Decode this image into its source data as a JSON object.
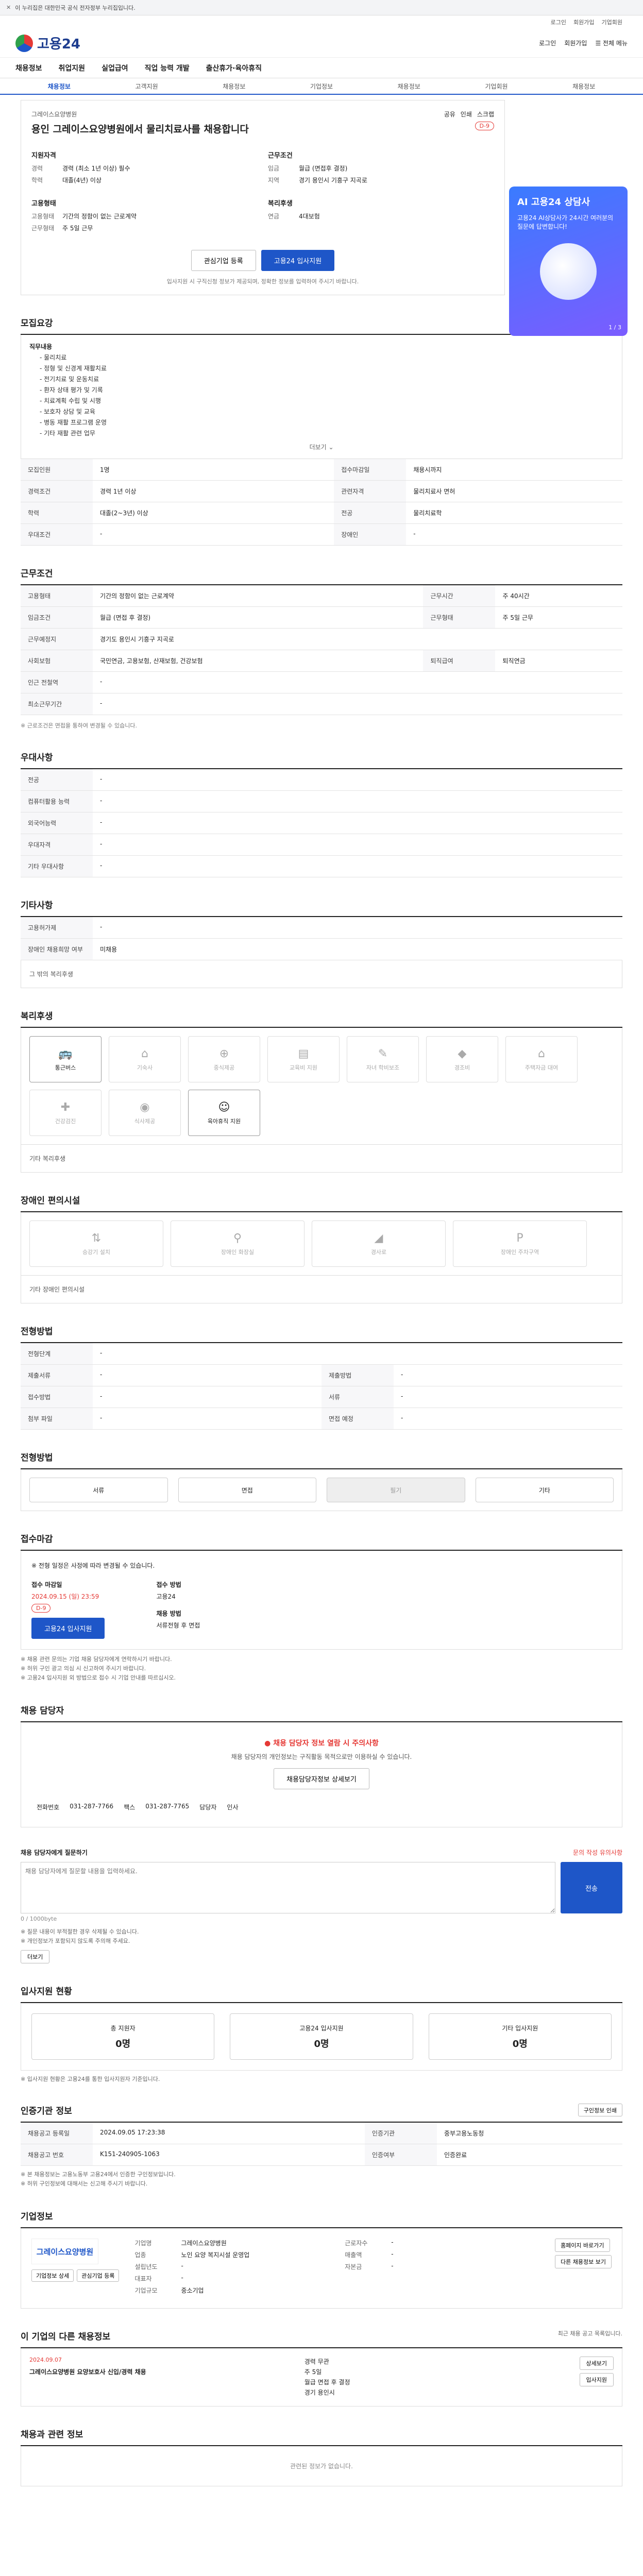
{
  "topbar": {
    "notice": "이 누리집은 대한민국 공식 전자정부 누리집입니다."
  },
  "gnb": [
    "로그인",
    "회원가입",
    "기업회원"
  ],
  "header": {
    "logo": "고용24",
    "links": [
      "로그인",
      "회원가입"
    ],
    "all_menu": "전체 메뉴"
  },
  "nav": [
    "채용정보",
    "취업지원",
    "실업급여",
    "직업 능력 개발",
    "출산휴가·육아휴직"
  ],
  "subnav": [
    "채용정보",
    "고객지원",
    "채용정보",
    "기업정보",
    "채용정보",
    "기업회원",
    "채용정보"
  ],
  "banner": {
    "title": "AI 고용24 상담사",
    "text": "고용24 AI상담사가 24시간 여러분의 질문에 답변합니다!",
    "page": "1 / 3"
  },
  "job": {
    "company": "그레이스요양병원",
    "title": "용인 그레이스요양병원에서 물리치료사를 채용합니다",
    "tools": [
      "공유",
      "인쇄",
      "스크랩"
    ],
    "badge": "D-9",
    "summary": {
      "left_title": "지원자격",
      "left": [
        [
          "경력",
          "경력 (최소 1년 이상) 필수"
        ],
        [
          "학력",
          "대졸(4년) 이상"
        ]
      ],
      "right_title": "근무조건",
      "right": [
        [
          "임금",
          "월급 (면접후 결정)"
        ],
        [
          "지역",
          "경기 용인시 기흥구 지곡로"
        ]
      ],
      "left2_title": "고용형태",
      "left2": [
        [
          "고용형태",
          "기간의 정함이 없는 근로계약"
        ],
        [
          "근무형태",
          "주 5일 근무"
        ]
      ],
      "right2_title": "복리후생",
      "right2": [
        [
          "연금",
          "4대보험"
        ]
      ]
    },
    "apply_buttons": [
      "관심기업 등록",
      "고용24 입사지원"
    ],
    "note": "입사지원 시 구직신청 정보가 제공되며, 정확한 정보를 입력하여 주시기 바랍니다."
  },
  "duty": {
    "title": "모집요강",
    "head": "직무내용",
    "items": [
      "- 물리치료",
      "- 정형 및 신경계 재활치료",
      "- 전기치료 및 운동치료",
      "- 환자 상태 평가 및 기록",
      "- 치료계획 수립 및 시행",
      "- 보호자 상담 및 교육",
      "- 병동 재활 프로그램 운영",
      "- 기타 재활 관련 업무"
    ],
    "more": "더보기",
    "rows": [
      [
        "모집인원",
        "1명",
        "접수마감일",
        "채용시까지"
      ],
      [
        "경력조건",
        "경력 1년 이상",
        "관련자격",
        "물리치료사 면허"
      ],
      [
        "학력",
        "대졸(2~3년) 이상",
        "전공",
        "물리치료학"
      ],
      [
        "우대조건",
        "-",
        "장애인",
        "-"
      ]
    ]
  },
  "cond": {
    "title": "근무조건",
    "rows": [
      [
        "고용형태",
        "기간의 정함이 없는 근로계약",
        "근무시간",
        "주 40시간"
      ],
      [
        "임금조건",
        "월급 (면접 후 결정)",
        "근무형태",
        "주 5일 근무"
      ],
      [
        "근무예정지",
        "경기도 용인시 기흥구 지곡로",
        "",
        ""
      ],
      [
        "사회보험",
        "국민연금, 고용보험, 산재보험, 건강보험",
        "퇴직급여",
        "퇴직연금"
      ],
      [
        "인근 전철역",
        "-",
        "",
        ""
      ],
      [
        "최소근무기간",
        "-",
        "",
        ""
      ]
    ],
    "note": "※ 근로조건은 면접을 통하여 변경될 수 있습니다."
  },
  "pref": {
    "title": "우대사항",
    "rows": [
      [
        "전공",
        "-"
      ],
      [
        "컴퓨터활용 능력",
        "-"
      ],
      [
        "외국어능력",
        "-"
      ],
      [
        "우대자격",
        "-"
      ],
      [
        "기타 우대사항",
        "-"
      ]
    ]
  },
  "etc": {
    "title": "기타사항",
    "rows": [
      [
        "고용허가제",
        "-"
      ],
      [
        "장애인 채용희망 여부",
        "미채용"
      ]
    ],
    "sub": "그 밖의 복리후생"
  },
  "welfare": {
    "title": "복리후생",
    "items": [
      "통근버스",
      "기숙사",
      "중식제공",
      "교육비 지원",
      "자녀 학비보조",
      "경조비",
      "주택자금 대여",
      "건강검진",
      "식사제공",
      "육아휴직 지원"
    ],
    "on": [
      0,
      9
    ],
    "sub": "기타 복리후생"
  },
  "facility": {
    "title": "장애인 편의시설",
    "items": [
      "승강기 설치",
      "장애인 화장실",
      "경사로",
      "장애인 주차구역"
    ],
    "sub": "기타 장애인 편의시설"
  },
  "screening": {
    "title": "전형방법",
    "rows": [
      [
        "전형단계",
        "-"
      ],
      [
        "제출서류",
        "-",
        "제출방법",
        "-"
      ],
      [
        "접수방법",
        "-",
        "서류",
        "-"
      ],
      [
        "첨부 파일",
        "-",
        "면접 예정",
        "-"
      ]
    ]
  },
  "method": {
    "title": "전형방법",
    "items": [
      "서류",
      "면접",
      "필기",
      "기타"
    ],
    "off_index": 2
  },
  "deadline": {
    "title": "접수마감",
    "text": "※ 전형 일정은 사정에 따라 변경될 수 있습니다.",
    "date_label": "접수 마감일",
    "date": "2024.09.15 (일) 23:59",
    "badge": "D-9",
    "apply": "고용24 입사지원",
    "method_label": "접수 방법",
    "method": "고용24",
    "mgr_label": "채용 방법",
    "mgr": "서류전형 후 면접",
    "notes": [
      "※ 채용 관련 문의는 기업 채용 담당자에게 연락하시기 바랍니다.",
      "※ 허위 구인 광고 의심 시 신고하여 주시기 바랍니다.",
      "※ 고용24 입사지원 외 방법으로 접수 시 기업 안내를 따르십시오."
    ]
  },
  "contact": {
    "title": "채용 담당자",
    "warn": "채용 담당자 정보 열람 시 주의사항",
    "text": "채용 담당자의 개인정보는 구직활동 목적으로만 이용하실 수 있습니다.",
    "button": "채용담당자정보 상세보기",
    "phone_label": "전화번호",
    "phone": "031-287-7766",
    "fax_label": "팩스",
    "fax": "031-287-7765",
    "mgr_label": "담당자",
    "mgr": "인사"
  },
  "inquiry": {
    "title": "채용 담당자에게 질문하기",
    "policy": "문의 작성 유의사항",
    "placeholder": "채용 담당자에게 질문할 내용을 입력하세요.",
    "count": "0 / 1000byte",
    "button": "전송",
    "notes": [
      "※ 질문 내용이 부적절한 경우 삭제될 수 있습니다.",
      "※ 개인정보가 포함되지 않도록 주의해 주세요."
    ],
    "more_button": "더보기"
  },
  "stats": {
    "title": "입사지원 현황",
    "items": [
      [
        "총 지원자",
        "0명"
      ],
      [
        "고용24 입사지원",
        "0명"
      ],
      [
        "기타 입사지원",
        "0명"
      ]
    ],
    "note": "※ 입사지원 현황은 고용24를 통한 입사지원자 기준입니다."
  },
  "info": {
    "title": "인증기관 정보",
    "print": "구인정보 인쇄",
    "rows": [
      [
        "채용공고 등록일",
        "2024.09.05 17:23:38",
        "인증기관",
        "중부고용노동청"
      ],
      [
        "채용공고 번호",
        "K151-240905-1063",
        "인증여부",
        "인증완료"
      ]
    ],
    "notes": [
      "※ 본 채용정보는 고용노동부 고용24에서 인증한 구인정보입니다.",
      "※ 허위 구인정보에 대해서는 신고해 주시기 바랍니다."
    ]
  },
  "company": {
    "title": "기업정보",
    "logo": "그레이스요양병원",
    "rows": [
      [
        "기업명",
        "그레이스요양병원"
      ],
      [
        "업종",
        "노인 요양 복지시설 운영업"
      ],
      [
        "설립년도",
        "-"
      ],
      [
        "대표자",
        "-"
      ],
      [
        "기업규모",
        "중소기업"
      ]
    ],
    "right": [
      [
        "근로자수",
        "-"
      ],
      [
        "매출액",
        "-"
      ],
      [
        "자본금",
        "-"
      ]
    ],
    "btns": [
      "기업정보 상세",
      "관심기업 등록",
      "다른 채용정보 보기"
    ],
    "homepage": "홈페이지 바로가기"
  },
  "similar": {
    "title": "이 기업의 다른 채용정보",
    "sub": "최근 채용 공고 목록입니다.",
    "date": "2024.09.07",
    "job_title": "그레이스요양병원 요양보호사 신입/경력 채용",
    "details": [
      "경력 무관",
      "주 5일",
      "월급 면접 후 결정",
      "경기 용인시"
    ],
    "btns": [
      "상세보기",
      "입사지원"
    ]
  },
  "related": {
    "title": "채용과 관련 정보",
    "empty": "관련된 정보가 없습니다."
  }
}
